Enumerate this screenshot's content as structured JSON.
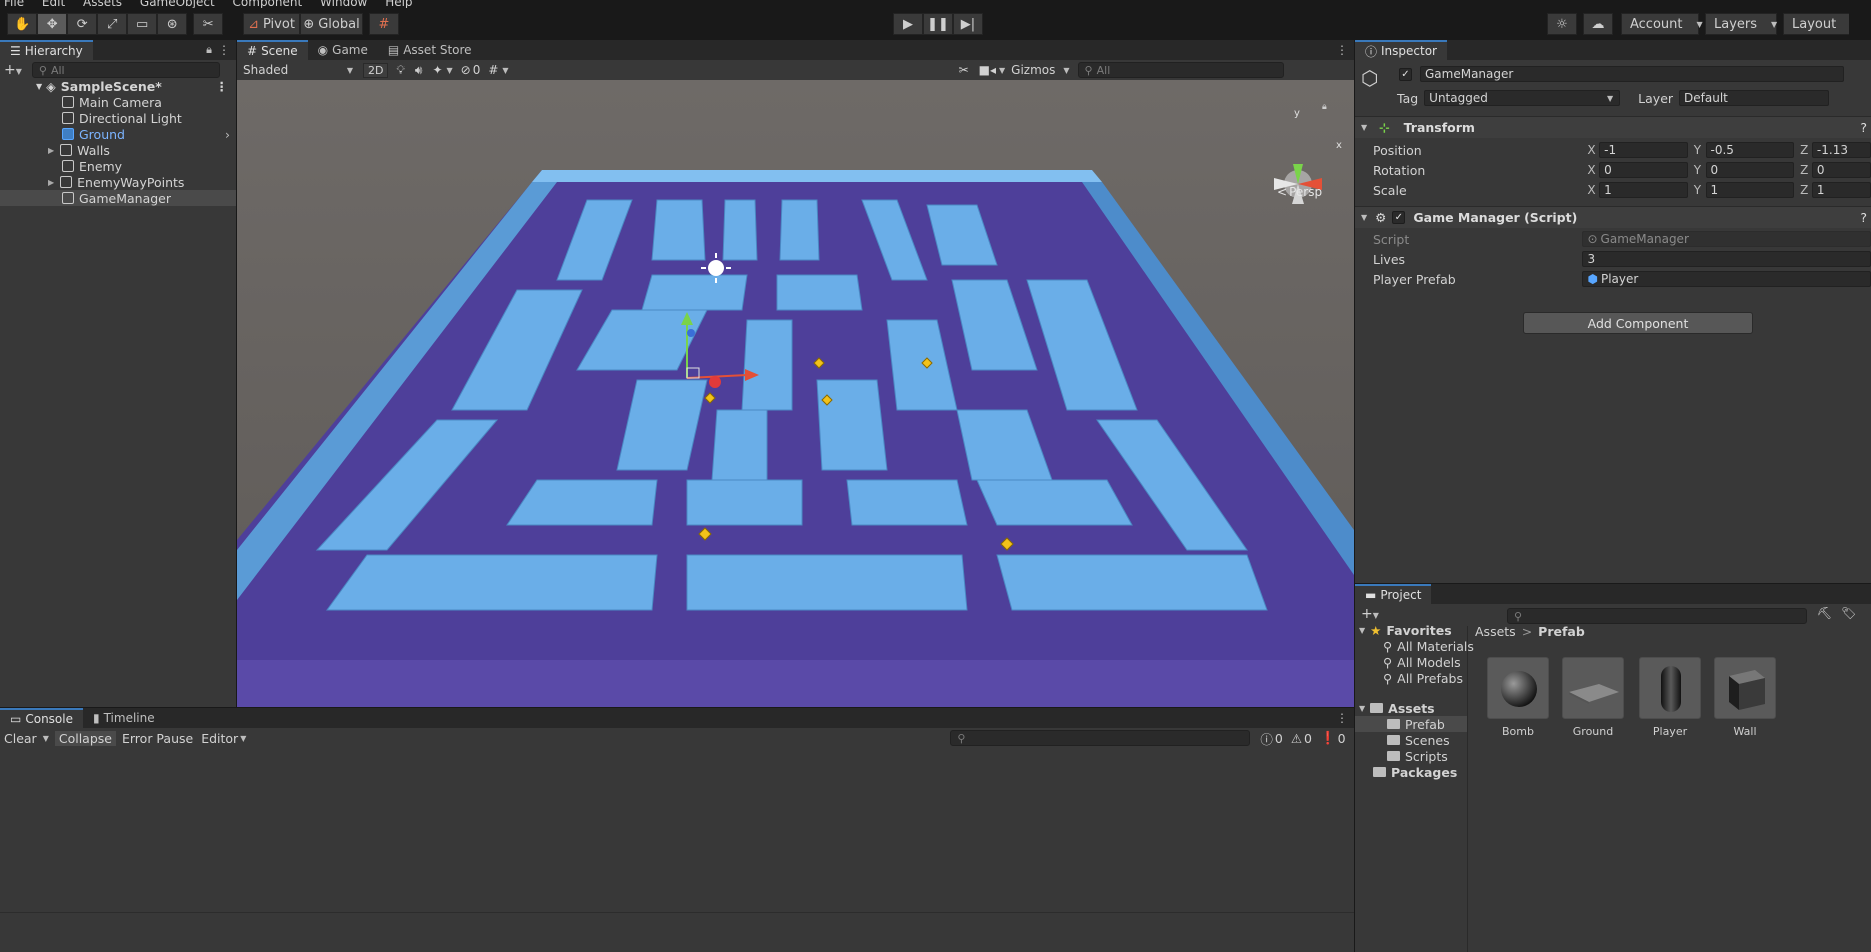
{
  "menu": [
    "File",
    "Edit",
    "Assets",
    "GameObject",
    "Component",
    "Window",
    "Help"
  ],
  "toolbar": {
    "tools": [
      "hand-icon",
      "move-icon",
      "rotate-icon",
      "scale-icon",
      "rect-icon",
      "transform-icon",
      "custom-tool-icon"
    ],
    "pivot_label": "Pivot",
    "global_label": "Global",
    "account_label": "Account",
    "layers_label": "Layers",
    "layout_label": "Layout"
  },
  "hierarchy": {
    "tab_label": "Hierarchy",
    "search_placeholder": "All",
    "scene_name": "SampleScene*",
    "items": [
      "Main Camera",
      "Directional Light",
      "Ground",
      "Walls",
      "Enemy",
      "EnemyWayPoints",
      "GameManager"
    ]
  },
  "scene": {
    "tabs": [
      "Scene",
      "Game",
      "Asset Store"
    ],
    "shading": "Shaded",
    "mode_2d": "2D",
    "hidden_count": "0",
    "gizmos_label": "Gizmos",
    "search_placeholder": "All",
    "persp_label": "Persp",
    "axis_y": "y",
    "axis_x": "x",
    "colors": {
      "wall": "#6aaee8",
      "floor": "#4e3f9a",
      "sky": "#6b6764"
    }
  },
  "inspector": {
    "tab_label": "Inspector",
    "object_name": "GameManager",
    "tag_label": "Tag",
    "tag_value": "Untagged",
    "layer_label": "Layer",
    "layer_value": "Default",
    "transform_title": "Transform",
    "position_label": "Position",
    "rotation_label": "Rotation",
    "scale_label": "Scale",
    "axis_x": "X",
    "axis_y": "Y",
    "axis_z": "Z",
    "position": {
      "x": "-1",
      "y": "-0.5",
      "z": "-1.13"
    },
    "rotation": {
      "x": "0",
      "y": "0",
      "z": "0"
    },
    "scale": {
      "x": "1",
      "y": "1",
      "z": "1"
    },
    "script_component_title": "Game Manager (Script)",
    "script_label": "Script",
    "script_value": "GameManager",
    "lives_label": "Lives",
    "lives_value": "3",
    "player_prefab_label": "Player Prefab",
    "player_prefab_value": "Player",
    "add_component_label": "Add Component"
  },
  "project": {
    "tab_label": "Project",
    "favorites_label": "Favorites",
    "favorites": [
      "All Materials",
      "All Models",
      "All Prefabs"
    ],
    "assets_label": "Assets",
    "asset_folders": [
      "Prefab",
      "Scenes",
      "Scripts"
    ],
    "packages_label": "Packages",
    "breadcrumb_root": "Assets",
    "breadcrumb_sep": ">",
    "breadcrumb_current": "Prefab",
    "items": [
      "Bomb",
      "Ground",
      "Player",
      "Wall"
    ]
  },
  "console": {
    "tabs": [
      "Console",
      "Timeline"
    ],
    "clear_label": "Clear",
    "collapse_label": "Collapse",
    "error_pause_label": "Error Pause",
    "editor_label": "Editor",
    "log_count": "0",
    "warn_count": "0",
    "error_count": "0"
  }
}
